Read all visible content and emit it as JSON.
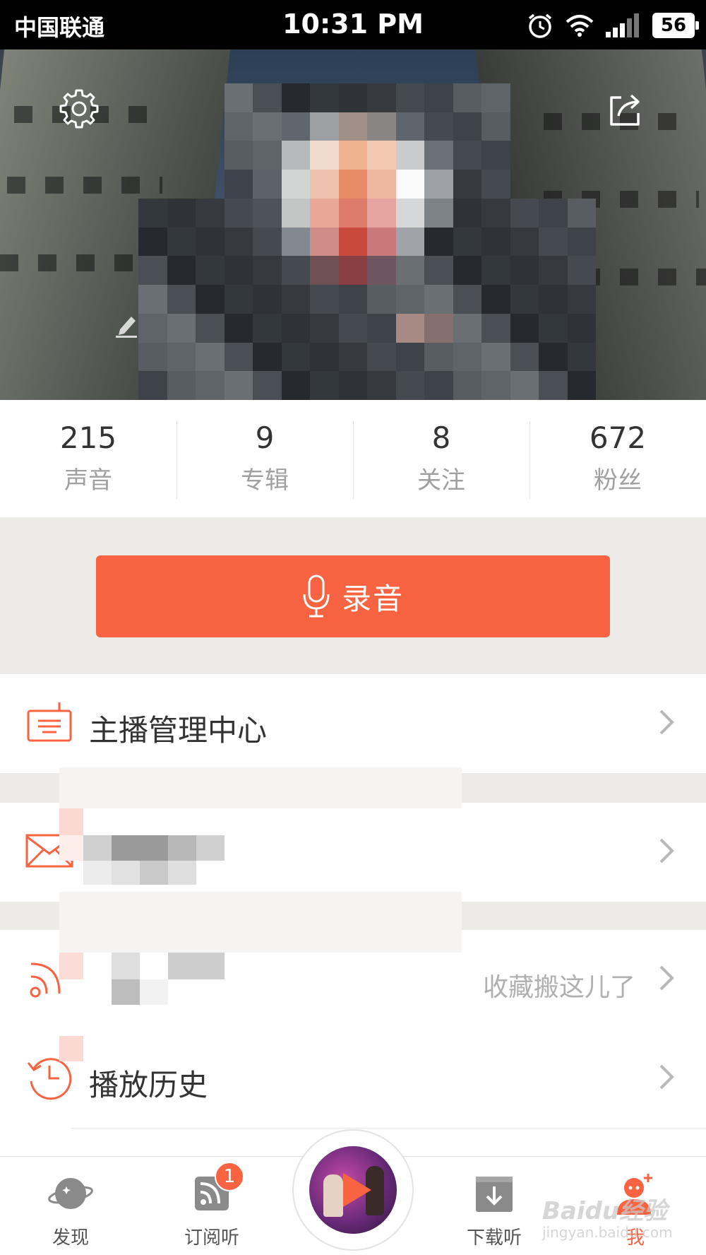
{
  "status_bar": {
    "carrier": "中国联通",
    "time": "10:31 PM",
    "battery": "56"
  },
  "header": {
    "settings_icon": "gear-icon",
    "share_icon": "share-icon",
    "edit_icon": "pencil-icon"
  },
  "stats": [
    {
      "value": "215",
      "label": "声音"
    },
    {
      "value": "9",
      "label": "专辑"
    },
    {
      "value": "8",
      "label": "关注"
    },
    {
      "value": "672",
      "label": "粉丝"
    }
  ],
  "record_button": {
    "label": "录音",
    "icon": "microphone-icon"
  },
  "menu": [
    {
      "label": "主播管理中心",
      "icon": "anchor-center-icon",
      "extra": ""
    },
    {
      "label": "",
      "icon": "mail-icon",
      "extra": ""
    },
    {
      "label": "",
      "icon": "rss-icon",
      "extra": "收藏搬这儿了"
    },
    {
      "label": "播放历史",
      "icon": "history-clock-icon",
      "extra": ""
    }
  ],
  "tabs": [
    {
      "label": "发现",
      "icon": "planet-icon"
    },
    {
      "label": "订阅听",
      "icon": "subscribe-icon",
      "badge": "1"
    },
    {
      "label": "",
      "icon": "play-icon"
    },
    {
      "label": "下载听",
      "icon": "download-icon"
    },
    {
      "label": "我",
      "icon": "me-icon"
    }
  ],
  "watermark": {
    "main": "Baidu经验",
    "sub": "jingyan.baidu.com"
  },
  "colors": {
    "accent": "#f86442",
    "text": "#333333",
    "muted": "#a0a0a0",
    "band": "#ecebe8"
  }
}
